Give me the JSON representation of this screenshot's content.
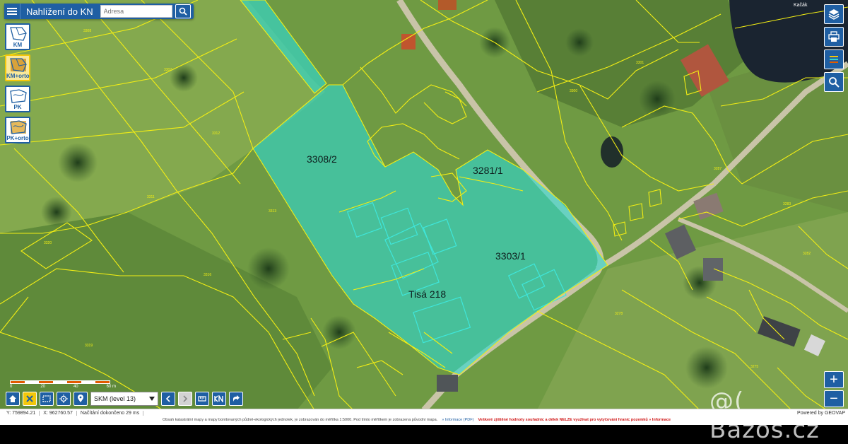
{
  "header": {
    "app_title": "Nahlížení do KN",
    "address_placeholder": "Adresa"
  },
  "layers": [
    {
      "label": "KM",
      "active": false
    },
    {
      "label": "KM+orto",
      "active": true
    },
    {
      "label": "PK",
      "active": false
    },
    {
      "label": "PK+orto",
      "active": false
    }
  ],
  "map": {
    "parcels": [
      {
        "label": "3308/2"
      },
      {
        "label": "3281/1"
      },
      {
        "label": "3303/1"
      },
      {
        "label": "Tisá 218"
      }
    ],
    "place_label": "Kačák",
    "highlight_color": "#2fd8d0",
    "boundary_color": "#f3ee14"
  },
  "scale": {
    "ticks": [
      "0",
      "20",
      "40",
      "60 m"
    ]
  },
  "toolbar": {
    "layer_select_value": "SKM (level 13)"
  },
  "status": {
    "y_coord": "Y: 759894.21",
    "x_coord": "X: 962760.57",
    "loading": "Načítání dokončeno 29 ms",
    "notice": "Obsah katastrální mapy a mapy bonitovaných půdně-ekologických jednotek, je zobrazován do měřítka 1:5000. Pod tímto měřítkem je zobrazena původní mapa.",
    "link_text": "» Informace (PDF)",
    "warning": "Veškeré zjištěné hodnoty souřadnic a délek NELZE využívat pro vytyčování hranic pozemků » Informace",
    "powered": "Powered by GEOVAP"
  },
  "watermark": "@( Bazos.cz"
}
